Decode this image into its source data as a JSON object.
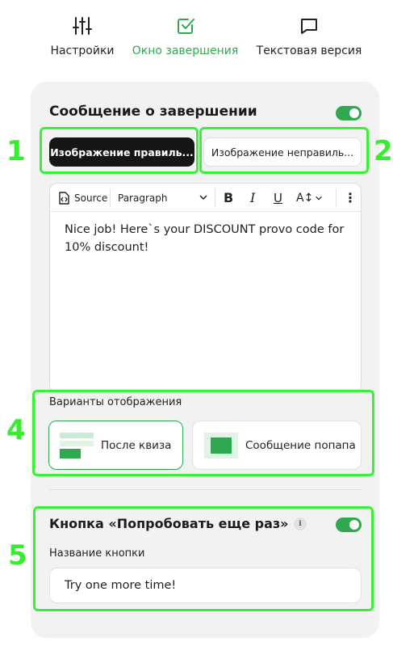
{
  "tabs": [
    {
      "label": "Настройки",
      "icon": "sliders-icon",
      "active": false
    },
    {
      "label": "Окно завершения",
      "icon": "checkbox-icon",
      "active": true
    },
    {
      "label": "Текстовая версия",
      "icon": "chat-bubble-icon",
      "active": false
    }
  ],
  "completion": {
    "title": "Сообщение о завершении",
    "enabled": true,
    "correct_image_label": "Изображение правиль...",
    "incorrect_image_label": "Изображение неправиль..."
  },
  "editor": {
    "source_label": "Source",
    "format_value": "Paragraph",
    "bold": "B",
    "italic": "I",
    "underline": "U",
    "font_size": "A↕",
    "more": "⋮",
    "content": "Nice job! Here`s your DISCOUNT provo code for 10% discount!"
  },
  "display": {
    "label": "Варианты отображения",
    "options": [
      {
        "label": "После квиза",
        "selected": true
      },
      {
        "label": "Сообщение попапа",
        "selected": false
      }
    ]
  },
  "retry": {
    "title": "Кнопка «Попробовать еще раз»",
    "info": "i",
    "enabled": true,
    "field_label": "Название кнопки",
    "field_value": "Try one more time!"
  },
  "annotations": [
    "1",
    "2",
    "4",
    "5"
  ],
  "colors": {
    "accent": "#2fa84f",
    "highlight": "#3bf03b",
    "dark_button": "#161616",
    "panel": "#f2f2f2"
  }
}
